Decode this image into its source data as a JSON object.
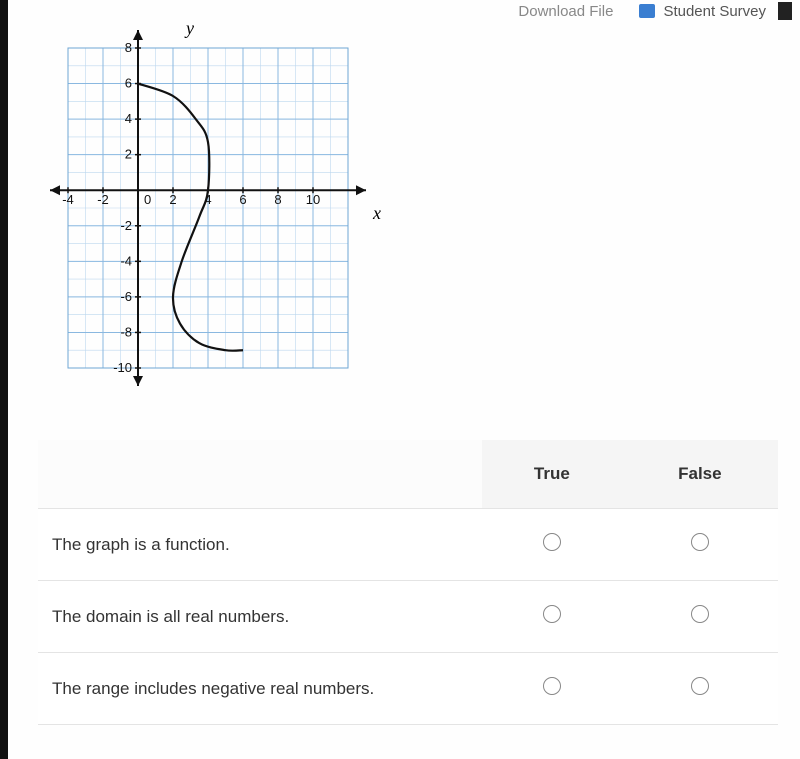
{
  "toolbar": {
    "partial1": "Download File",
    "survey_label": "Student Survey"
  },
  "chart_data": {
    "type": "line",
    "title": "",
    "xlabel": "x",
    "ylabel": "y",
    "xlim": [
      -4,
      12
    ],
    "ylim": [
      -10,
      8
    ],
    "x_ticks": [
      -4,
      -2,
      0,
      2,
      4,
      6,
      8,
      10
    ],
    "y_ticks": [
      -10,
      -8,
      -6,
      -4,
      -2,
      2,
      4,
      6,
      8
    ],
    "series": [
      {
        "name": "curve",
        "points": [
          {
            "x": 0,
            "y": 6
          },
          {
            "x": 2,
            "y": 5.3
          },
          {
            "x": 3.3,
            "y": 4
          },
          {
            "x": 4,
            "y": 2.7
          },
          {
            "x": 4,
            "y": 0
          },
          {
            "x": 3.5,
            "y": -1.5
          },
          {
            "x": 2.5,
            "y": -4
          },
          {
            "x": 2,
            "y": -6
          },
          {
            "x": 2.4,
            "y": -7.5
          },
          {
            "x": 3.5,
            "y": -8.6
          },
          {
            "x": 5,
            "y": -9
          },
          {
            "x": 6,
            "y": -9
          }
        ]
      }
    ]
  },
  "table": {
    "headers": [
      "",
      "True",
      "False"
    ],
    "rows": [
      {
        "statement": "The graph is a function.",
        "name": "is-function"
      },
      {
        "statement": "The domain is all real numbers.",
        "name": "domain-all-reals"
      },
      {
        "statement": "The range includes negative real numbers.",
        "name": "range-negative"
      }
    ]
  }
}
